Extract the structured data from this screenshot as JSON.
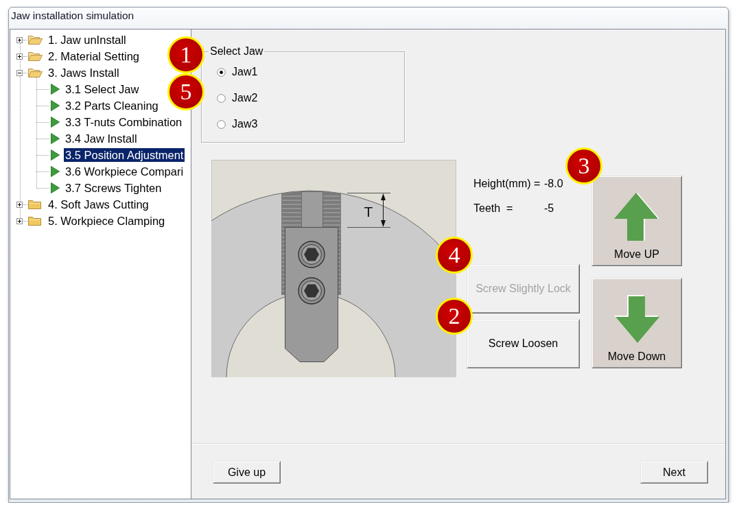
{
  "window": {
    "title": "Jaw installation simulation"
  },
  "tree": [
    {
      "label": "1. Jaw unInstall",
      "kind": "folder",
      "expanded": false,
      "folder_open": true,
      "selected": false
    },
    {
      "label": "2. Material Setting",
      "kind": "folder",
      "expanded": false,
      "folder_open": true,
      "selected": false
    },
    {
      "label": "3. Jaws Install",
      "kind": "folder",
      "expanded": true,
      "folder_open": true,
      "selected": false,
      "children": [
        {
          "label": "3.1 Select Jaw",
          "kind": "step",
          "selected": false
        },
        {
          "label": "3.2 Parts Cleaning",
          "kind": "step",
          "selected": false
        },
        {
          "label": "3.3 T-nuts Combination",
          "kind": "step",
          "selected": false
        },
        {
          "label": "3.4 Jaw Install",
          "kind": "step",
          "selected": false
        },
        {
          "label": "3.5 Position Adjustment",
          "kind": "step",
          "selected": true
        },
        {
          "label": "3.6 Workpiece Compari",
          "kind": "step",
          "selected": false
        },
        {
          "label": "3.7 Screws Tighten",
          "kind": "step",
          "selected": false
        }
      ]
    },
    {
      "label": "4. Soft Jaws Cutting",
      "kind": "folder",
      "expanded": false,
      "folder_open": false,
      "selected": false
    },
    {
      "label": "5. Workpiece Clamping",
      "kind": "folder",
      "expanded": false,
      "folder_open": false,
      "selected": false
    }
  ],
  "select_jaw": {
    "title": "Select Jaw",
    "callouts": [
      "1",
      "5"
    ],
    "options": [
      {
        "label": "Jaw1",
        "selected": true
      },
      {
        "label": "Jaw2",
        "selected": false
      },
      {
        "label": "Jaw3",
        "selected": false
      }
    ]
  },
  "diagram": {
    "dimension_label": "T"
  },
  "readings": [
    {
      "label": "Height(mm) =",
      "value": "-8.0"
    },
    {
      "label": "Teeth  =",
      "value": "-5"
    }
  ],
  "actions": [
    {
      "label": "Screw Slightly Lock",
      "disabled": true,
      "callout": "4"
    },
    {
      "label": "Screw Loosen",
      "disabled": false,
      "callout": "2"
    }
  ],
  "move_buttons": [
    {
      "label": "Move UP",
      "kind": "up",
      "callout": "3"
    },
    {
      "label": "Move Down",
      "kind": "down"
    }
  ],
  "footer_buttons": [
    {
      "label": "Give up"
    },
    {
      "label": "Next"
    }
  ]
}
